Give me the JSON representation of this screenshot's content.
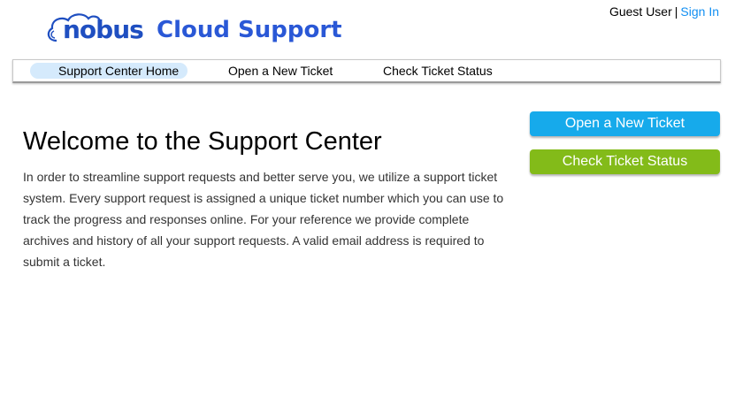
{
  "header": {
    "logo_nobus": "nobus",
    "logo_rest": "Cloud Support",
    "user_label": "Guest User",
    "separator": "|",
    "sign_in": "Sign In"
  },
  "nav": {
    "items": [
      {
        "label": "Support Center Home",
        "active": true
      },
      {
        "label": "Open a New Ticket",
        "active": false
      },
      {
        "label": "Check Ticket Status",
        "active": false
      }
    ]
  },
  "main": {
    "title": "Welcome to the Support Center",
    "intro": "In order to streamline support requests and better serve you, we utilize a support ticket system. Every support request is assigned a unique ticket number which you can use to track the progress and responses online. For your reference we provide complete archives and history of all your support requests. A valid email address is required to submit a ticket."
  },
  "sidebar": {
    "open_ticket": "Open a New Ticket",
    "check_status": "Check Ticket Status"
  },
  "colors": {
    "brand": "#1f4fc1",
    "link": "#128ff2",
    "open_button": "#16aaeb",
    "check_button": "#83bb19",
    "nav_active": "#d5eafc"
  },
  "icons": [
    "cloud-logo-icon"
  ]
}
